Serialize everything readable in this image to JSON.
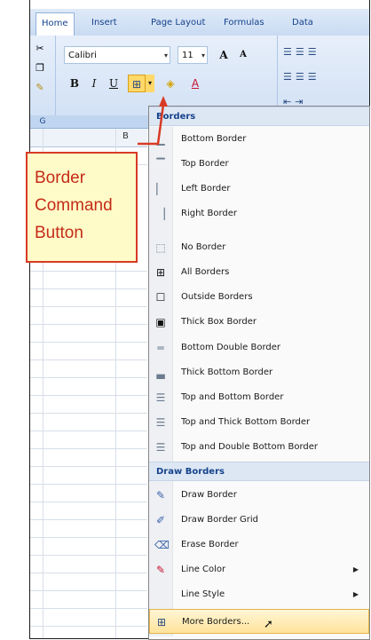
{
  "ribbon": {
    "tabs": [
      "Home",
      "Insert",
      "Page Layout",
      "Formulas",
      "Data"
    ],
    "font_name": "Calibri",
    "font_size": "11",
    "group_font_caption": "Fo",
    "clipboard_caption": "G",
    "cell_ref": "B"
  },
  "callout": {
    "line1": "Border",
    "line2": "Command",
    "line3": "Button"
  },
  "menu": {
    "header_borders": "Borders",
    "header_draw": "Draw Borders",
    "items": [
      {
        "label": "Bottom Border",
        "icon": "bottom-border-icon"
      },
      {
        "label": "Top Border",
        "icon": "top-border-icon"
      },
      {
        "label": "Left Border",
        "icon": "left-border-icon"
      },
      {
        "label": "Right Border",
        "icon": "right-border-icon"
      },
      {
        "label": "No Border",
        "icon": "no-border-icon"
      },
      {
        "label": "All Borders",
        "icon": "all-borders-icon"
      },
      {
        "label": "Outside Borders",
        "icon": "outside-borders-icon"
      },
      {
        "label": "Thick Box Border",
        "icon": "thick-box-border-icon"
      },
      {
        "label": "Bottom Double Border",
        "icon": "bottom-double-border-icon"
      },
      {
        "label": "Thick Bottom Border",
        "icon": "thick-bottom-border-icon"
      },
      {
        "label": "Top and Bottom Border",
        "icon": "top-bottom-border-icon"
      },
      {
        "label": "Top and Thick Bottom Border",
        "icon": "top-thick-bottom-border-icon"
      },
      {
        "label": "Top and Double Bottom Border",
        "icon": "top-double-bottom-border-icon"
      }
    ],
    "draw_items": [
      {
        "label": "Draw Border",
        "icon": "draw-border-icon"
      },
      {
        "label": "Draw Border Grid",
        "icon": "draw-border-grid-icon"
      },
      {
        "label": "Erase Border",
        "icon": "eraser-icon"
      },
      {
        "label": "Line Color",
        "icon": "line-color-icon"
      },
      {
        "label": "Line Style",
        "icon": "line-style-icon"
      },
      {
        "label": "More Borders...",
        "icon": "more-borders-icon"
      }
    ]
  },
  "colors": {
    "accent_red": "#d93a25",
    "callout_fill": "#fffbc8",
    "hover_fill": "#ffe39b"
  }
}
